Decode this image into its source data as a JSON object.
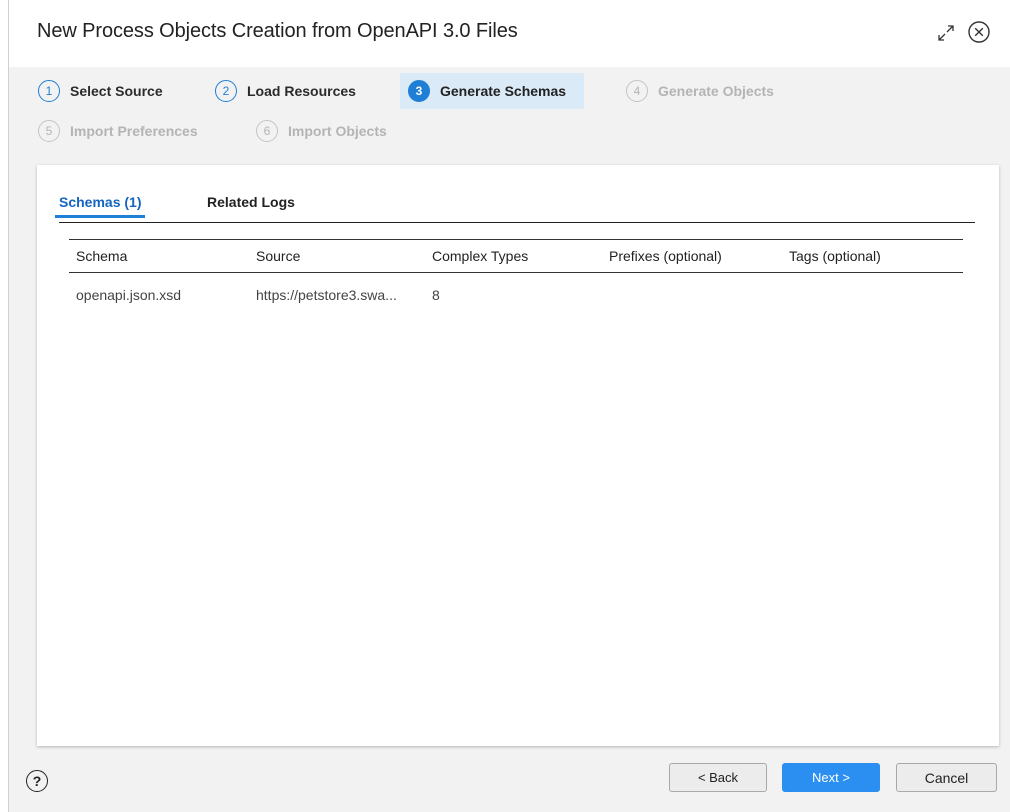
{
  "dialog": {
    "title": "New Process Objects Creation from OpenAPI 3.0 Files"
  },
  "steps": [
    {
      "number": "1",
      "label": "Select Source",
      "state": "done"
    },
    {
      "number": "2",
      "label": "Load Resources",
      "state": "done"
    },
    {
      "number": "3",
      "label": "Generate Schemas",
      "state": "active"
    },
    {
      "number": "4",
      "label": "Generate Objects",
      "state": "todo"
    },
    {
      "number": "5",
      "label": "Import Preferences",
      "state": "todo"
    },
    {
      "number": "6",
      "label": "Import Objects",
      "state": "todo"
    }
  ],
  "tabs": [
    {
      "label": "Schemas (1)",
      "active": true
    },
    {
      "label": "Related Logs",
      "active": false
    }
  ],
  "table": {
    "columns": [
      "Schema",
      "Source",
      "Complex Types",
      "Prefixes (optional)",
      "Tags (optional)"
    ],
    "rows": [
      [
        "openapi.json.xsd",
        "https://petstore3.swa...",
        "8",
        "",
        ""
      ]
    ]
  },
  "footer": {
    "help_glyph": "?",
    "back_label": "< Back",
    "next_label": "Next >",
    "cancel_label": "Cancel"
  },
  "colors": {
    "accent": "#1f7fd6",
    "active_step_bg": "#dbeaf7",
    "primary_button": "#2b8ff2",
    "disabled_text": "#b4b4b4"
  }
}
